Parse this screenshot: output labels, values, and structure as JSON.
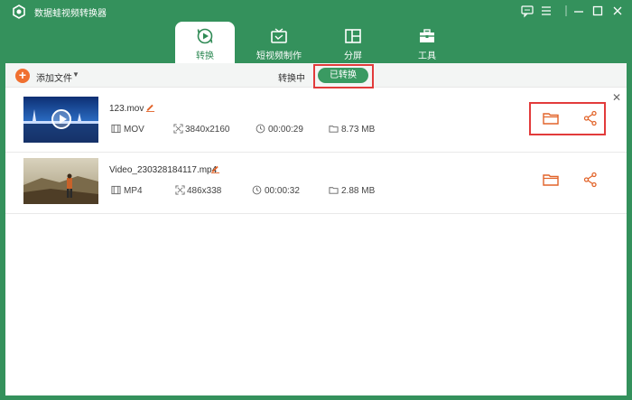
{
  "app": {
    "title": "数据蛙视频转换器"
  },
  "nav": {
    "tabs": [
      {
        "label": "转换",
        "icon": "convert-icon",
        "active": true
      },
      {
        "label": "短视频制作",
        "icon": "tv-icon",
        "active": false
      },
      {
        "label": "分屏",
        "icon": "split-screen-icon",
        "active": false
      },
      {
        "label": "工具",
        "icon": "toolbox-icon",
        "active": false
      }
    ]
  },
  "toolbar": {
    "add_label": "添加文件",
    "tab_converting": "转换中",
    "tab_converted": "已转换"
  },
  "files": [
    {
      "name": "123.mov",
      "format": "MOV",
      "resolution": "3840x2160",
      "duration": "00:00:29",
      "size": "8.73 MB"
    },
    {
      "name": "Video_230328184117.mp4",
      "format": "MP4",
      "resolution": "486x338",
      "duration": "00:00:32",
      "size": "2.88 MB"
    }
  ],
  "colors": {
    "brand": "#34915c",
    "accent": "#f07030",
    "highlight": "#e23b3b"
  }
}
